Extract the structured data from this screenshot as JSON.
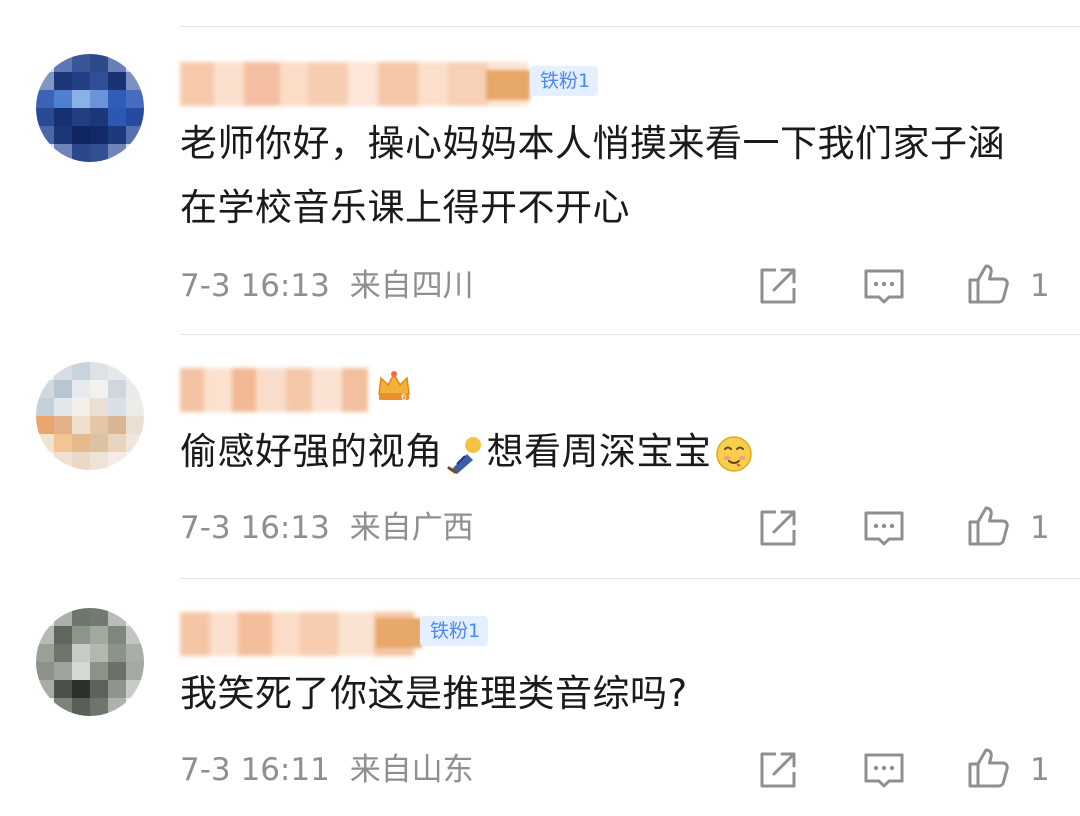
{
  "comments": [
    {
      "fan_badge": "铁粉1",
      "text": "老师你好，操心妈妈本人悄摸来看一下我们家子涵在学校音乐课上得开不开心",
      "time": "7-3 16:13",
      "location": "来自四川",
      "likes": "1"
    },
    {
      "fan_badge": "",
      "text_before": "偷感好强的视角",
      "text_after": "想看周深宝宝",
      "time": "7-3 16:13",
      "location": "来自广西",
      "likes": "1"
    },
    {
      "fan_badge": "铁粉1",
      "text": "我笑死了你这是推理类音综吗?",
      "time": "7-3 16:11",
      "location": "来自山东",
      "likes": "1"
    }
  ],
  "icons": {
    "share": "share-icon",
    "comment": "comment-icon",
    "like": "thumbs-up-icon",
    "crown": "crown-badge-icon",
    "sneak_emoji": "sneak-emoji-icon",
    "drool_emoji": "drool-emoji-icon"
  },
  "colors": {
    "text": "#1a1a1a",
    "meta": "#8f8f8f",
    "fan_badge_bg": "#e4efff",
    "fan_badge_text": "#4a8af0"
  }
}
